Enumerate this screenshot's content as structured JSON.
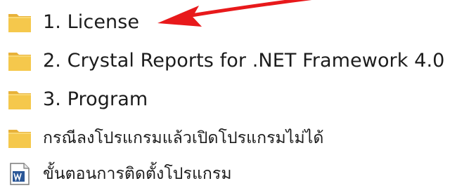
{
  "file_list": {
    "items": [
      {
        "label": "1. License",
        "icon": "folder-icon",
        "type": "folder"
      },
      {
        "label": "2. Crystal Reports for .NET Framework 4.0",
        "icon": "folder-icon",
        "type": "folder"
      },
      {
        "label": "3. Program",
        "icon": "folder-icon",
        "type": "folder"
      },
      {
        "label": "กรณีลงโปรแกรมแล้วเปิดโปรแกรมไม่ได้",
        "icon": "folder-icon",
        "type": "folder"
      },
      {
        "label": "ขั้นตอนการติดตั้งโปรแกรม",
        "icon": "word-document-icon",
        "type": "document"
      }
    ]
  },
  "annotation": {
    "arrow_color": "#e8191b",
    "arrow_icon": "red-arrow-annotation"
  },
  "colors": {
    "folder_body": "#f5c84c",
    "folder_tab": "#e8b23a",
    "folder_shade": "#dca532",
    "text": "#1c1c1c",
    "doc_blue": "#2b5797"
  }
}
